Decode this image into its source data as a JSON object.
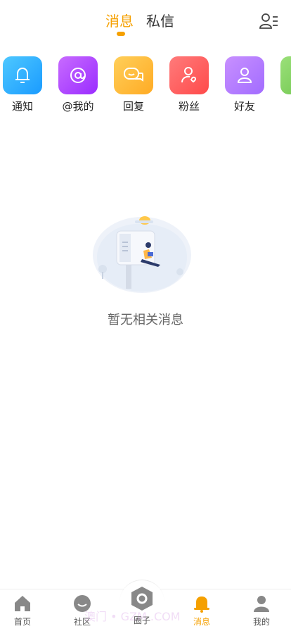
{
  "header": {
    "tabs": [
      {
        "label": "消息",
        "active": true
      },
      {
        "label": "私信",
        "active": false
      }
    ],
    "contacts_icon": "contacts-list-icon",
    "accent_color": "#f5a000"
  },
  "categories": [
    {
      "label": "通知",
      "icon": "bell-icon"
    },
    {
      "label": "@我的",
      "icon": "at-sign-icon"
    },
    {
      "label": "回复",
      "icon": "chat-bubble-icon"
    },
    {
      "label": "粉丝",
      "icon": "person-heart-icon"
    },
    {
      "label": "好友",
      "icon": "person-icon"
    },
    {
      "label": "",
      "icon": "partial-tile-icon"
    }
  ],
  "empty_state": {
    "text": "暂无相关消息",
    "illustration": "mailbox-reading-illustration"
  },
  "bottom_nav": [
    {
      "label": "首页",
      "icon": "home-icon",
      "active": false
    },
    {
      "label": "社区",
      "icon": "community-icon",
      "active": false
    },
    {
      "label": "圈子",
      "icon": "circle-hexagon-icon",
      "active": false
    },
    {
      "label": "消息",
      "icon": "bell-icon",
      "active": true
    },
    {
      "label": "我的",
      "icon": "user-icon",
      "active": false
    }
  ],
  "watermark": "澳门 • GZM .COM"
}
